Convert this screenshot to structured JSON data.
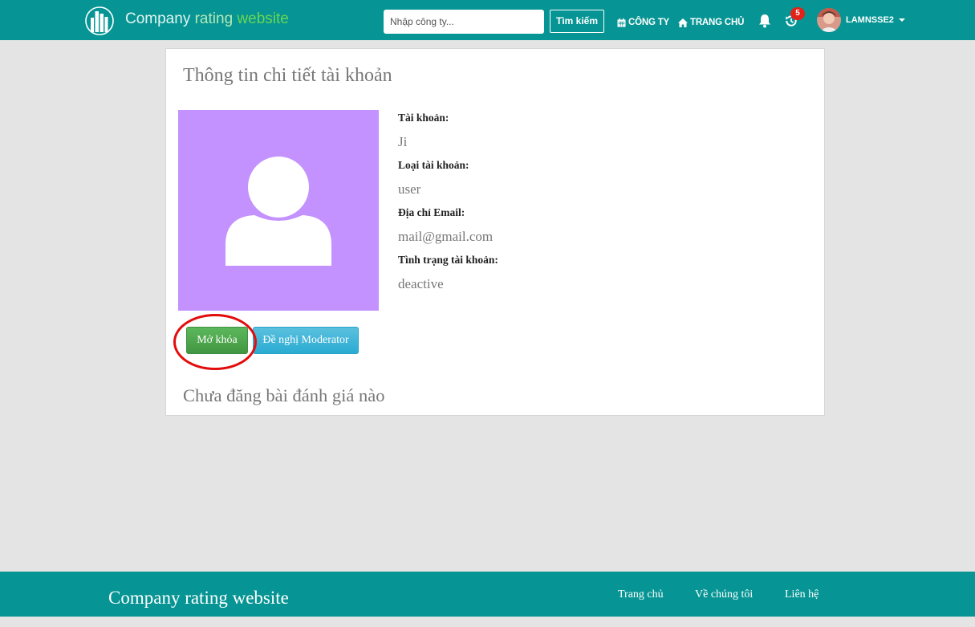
{
  "navbar": {
    "brand": {
      "part1": "Company",
      "part2": "rating",
      "part3": "website"
    },
    "search": {
      "placeholder": "Nhập công ty...",
      "button_label": "Tìm kiếm"
    },
    "links": {
      "company": "CÔNG TY",
      "home": "TRANG CHỦ"
    },
    "notification_count": "5",
    "username": "LAMNSSE2"
  },
  "account": {
    "title": "Thông tin chi tiết tài khoản",
    "fields": [
      {
        "label": "Tài khoản:",
        "value": "Ji"
      },
      {
        "label": "Loại tài khoản:",
        "value": "user"
      },
      {
        "label": "Địa chỉ Email:",
        "value": "mail@gmail.com"
      },
      {
        "label": "Tình trạng tài khoản:",
        "value": "deactive"
      }
    ],
    "buttons": {
      "unlock": "Mở khóa",
      "moderator": "Đề nghị Moderator"
    },
    "no_posts": "Chưa đăng bài đánh giá nào"
  },
  "footer": {
    "brand": "Company rating website",
    "links": {
      "home": "Trang chủ",
      "about": "Về chúng tôi",
      "contact": "Liên hệ"
    }
  },
  "colors": {
    "primary": "#069594",
    "avatar_bg": "#c392ff",
    "unlock": "#5cb85c",
    "moderator": "#5bc0de",
    "badge": "#e2231a",
    "highlight": "#e30c0c"
  },
  "icons": [
    "building-logo-icon",
    "calendar-icon",
    "home-icon",
    "bell-icon",
    "history-icon",
    "user-silhouette-icon",
    "caret-down-icon"
  ]
}
